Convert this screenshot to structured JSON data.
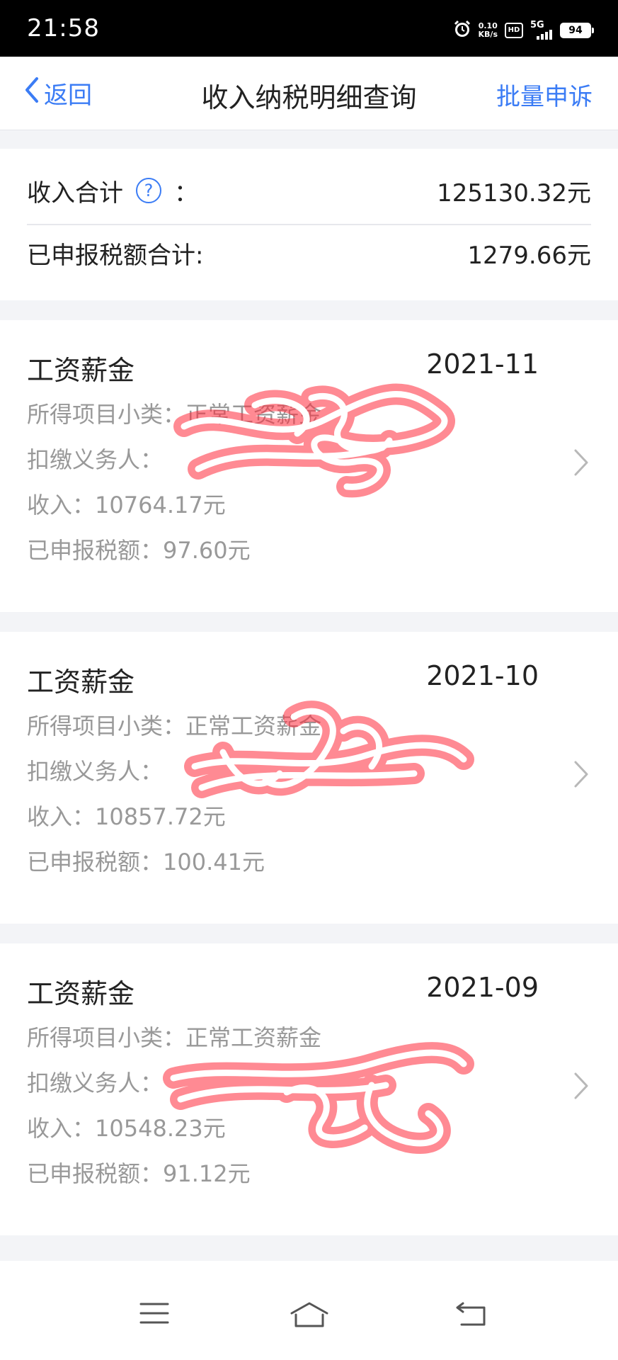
{
  "status_bar": {
    "time": "21:58",
    "speed_value": "0.10",
    "speed_unit": "KB/s",
    "hd": "HD",
    "network": "5G",
    "battery": "94"
  },
  "header": {
    "back_label": "返回",
    "title": "收入纳税明细查询",
    "action_label": "批量申诉"
  },
  "summary": {
    "income_label": "收入合计",
    "income_colon": "：",
    "income_value": "125130.32元",
    "tax_label": "已申报税额合计:",
    "tax_value": "1279.66元"
  },
  "records": [
    {
      "type": "工资薪金",
      "period": "2021-11",
      "subcategory_label": "所得项目小类：",
      "subcategory_value": "正常工资薪金",
      "withholder_label": "扣缴义务人：",
      "withholder_value": "",
      "income_label": "收入：",
      "income_value": "10764.17元",
      "tax_label": "已申报税额：",
      "tax_value": "97.60元"
    },
    {
      "type": "工资薪金",
      "period": "2021-10",
      "subcategory_label": "所得项目小类：",
      "subcategory_value": "正常工资薪金",
      "withholder_label": "扣缴义务人：",
      "withholder_value": "",
      "income_label": "收入：",
      "income_value": "10857.72元",
      "tax_label": "已申报税额：",
      "tax_value": "100.41元"
    },
    {
      "type": "工资薪金",
      "period": "2021-09",
      "subcategory_label": "所得项目小类：",
      "subcategory_value": "正常工资薪金",
      "withholder_label": "扣缴义务人：",
      "withholder_value": "",
      "income_label": "收入：",
      "income_value": "10548.23元",
      "tax_label": "已申报税额：",
      "tax_value": "91.12元"
    }
  ],
  "icons": {
    "back": "chevron-left-icon",
    "help": "question-circle-icon",
    "row_arrow": "chevron-right-icon",
    "nav_menu": "menu-icon",
    "nav_home": "home-icon",
    "nav_back": "back-icon"
  },
  "colors": {
    "accent": "#3b7cf5",
    "text_primary": "#222222",
    "text_secondary": "#999999",
    "background": "#f3f4f7",
    "redaction": "#ff2a3a"
  }
}
